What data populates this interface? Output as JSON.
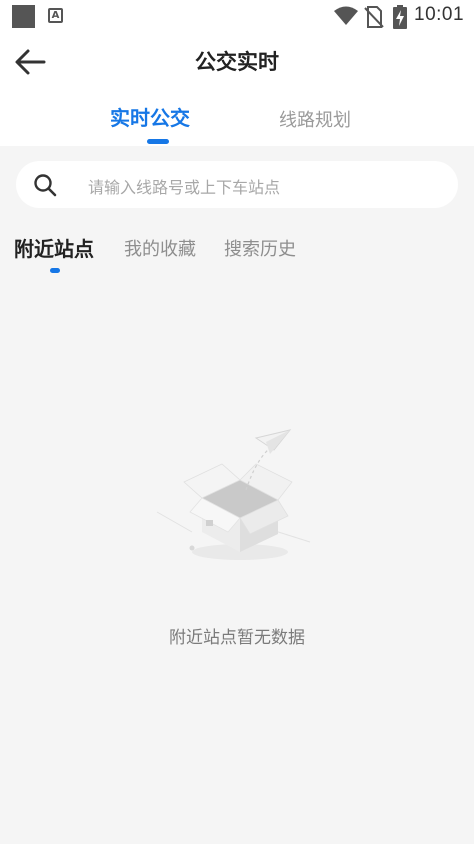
{
  "status_bar": {
    "time": "10:01",
    "notification_glyph": "A",
    "icons": [
      "square-notification-icon",
      "text-notification-icon",
      "wifi-icon",
      "no-sim-icon",
      "battery-charging-icon"
    ]
  },
  "header": {
    "title": "公交实时",
    "back_icon": "arrow-left-icon",
    "tabs": [
      {
        "label": "实时公交",
        "active": true
      },
      {
        "label": "线路规划",
        "active": false
      }
    ]
  },
  "search": {
    "placeholder": "请输入线路号或上下车站点",
    "icon": "search-icon"
  },
  "sub_tabs": [
    {
      "label": "附近站点",
      "active": true
    },
    {
      "label": "我的收藏",
      "active": false
    },
    {
      "label": "搜索历史",
      "active": false
    }
  ],
  "empty_state": {
    "message": "附近站点暂无数据",
    "illustration": "empty-box-paper-plane"
  },
  "colors": {
    "accent": "#1677e6",
    "background": "#f5f5f5",
    "surface": "#ffffff",
    "muted_text": "#9a9a9a"
  }
}
